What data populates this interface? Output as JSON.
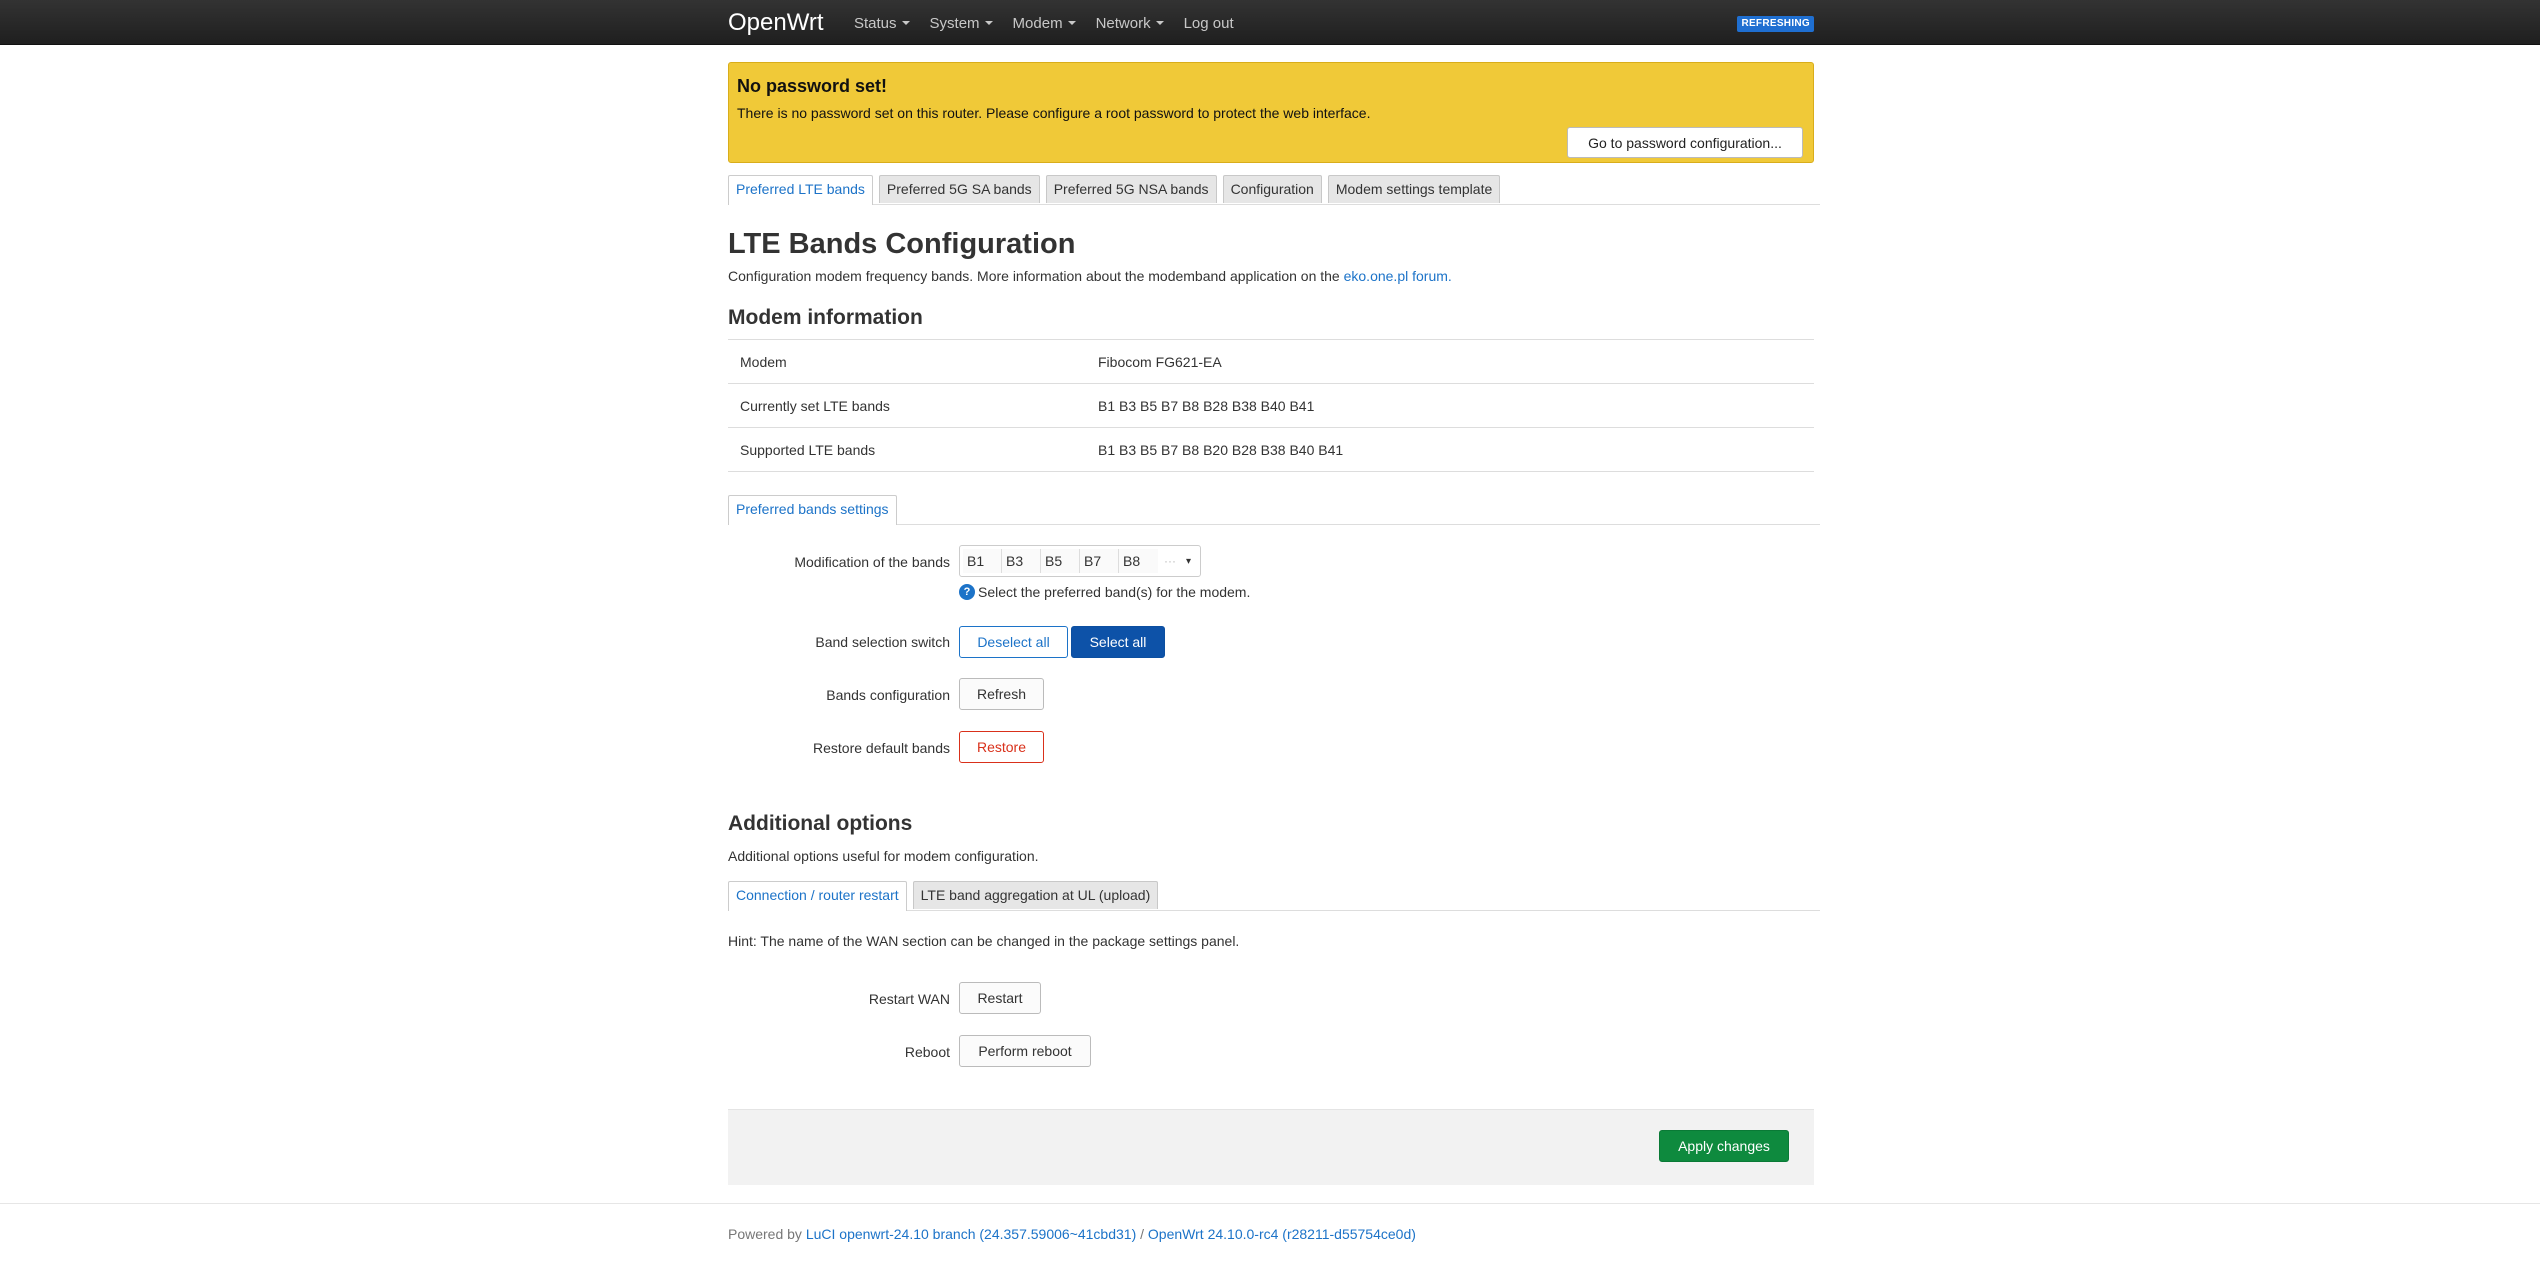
{
  "navbar": {
    "brand": "OpenWrt",
    "menu": [
      {
        "label": "Status",
        "dropdown": true
      },
      {
        "label": "System",
        "dropdown": true
      },
      {
        "label": "Modem",
        "dropdown": true
      },
      {
        "label": "Network",
        "dropdown": true
      },
      {
        "label": "Log out",
        "dropdown": false
      }
    ],
    "badge": "REFRESHING"
  },
  "alert": {
    "title": "No password set!",
    "text": "There is no password set on this router. Please configure a root password to protect the web interface.",
    "button": "Go to password configuration..."
  },
  "top_tabs": [
    "Preferred LTE bands",
    "Preferred 5G SA bands",
    "Preferred 5G NSA bands",
    "Configuration",
    "Modem settings template"
  ],
  "page": {
    "title": "LTE Bands Configuration",
    "description": "Configuration modem frequency bands. More information about the modemband application on the ",
    "description_link": "eko.one.pl forum."
  },
  "modem_info": {
    "heading": "Modem information",
    "rows": [
      {
        "key": "Modem",
        "value": "Fibocom FG621-EA"
      },
      {
        "key": "Currently set LTE bands",
        "value": "B1 B3 B5 B7 B8 B28 B38 B40 B41"
      },
      {
        "key": "Supported LTE bands",
        "value": "B1 B3 B5 B7 B8 B20 B28 B38 B40 B41"
      }
    ]
  },
  "settings_tab": "Preferred bands settings",
  "settings": {
    "modification_label": "Modification of the bands",
    "selected_bands": [
      "B1",
      "B3",
      "B5",
      "B7",
      "B8"
    ],
    "more": "···",
    "help_icon": "question-icon",
    "help_text": "Select the preferred band(s) for the modem.",
    "switch_label": "Band selection switch",
    "deselect_all": "Deselect all",
    "select_all": "Select all",
    "bands_config_label": "Bands configuration",
    "refresh": "Refresh",
    "restore_label": "Restore default bands",
    "restore": "Restore"
  },
  "additional": {
    "heading": "Additional options",
    "description": "Additional options useful for modem configuration.",
    "tabs": [
      "Connection / router restart",
      "LTE band aggregation at UL (upload)"
    ],
    "hint": "Hint: The name of the WAN section can be changed in the package settings panel.",
    "restart_wan_label": "Restart WAN",
    "restart": "Restart",
    "reboot_label": "Reboot",
    "perform_reboot": "Perform reboot"
  },
  "apply": "Apply changes",
  "footer": {
    "prefix": "Powered by ",
    "luci_link": "LuCI openwrt-24.10 branch (24.357.59006~41cbd31)",
    "separator": " / ",
    "openwrt_link": "OpenWrt 24.10.0-rc4 (r28211-d55754ce0d)"
  },
  "colors": {
    "accent": "#1c73c8",
    "alert": "#f0c938",
    "primary_button": "#0d52a8",
    "danger": "#d9301a",
    "success": "#0e8a3e"
  }
}
